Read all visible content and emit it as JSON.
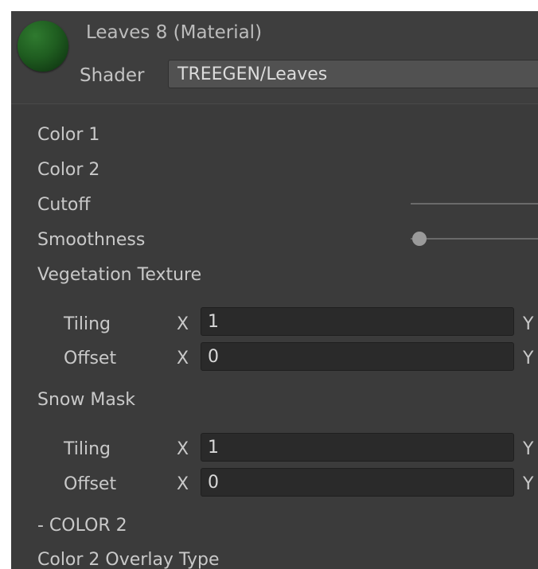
{
  "material": {
    "title": "Leaves 8 (Material)",
    "shader_label": "Shader",
    "shader_value": "TREEGEN/Leaves"
  },
  "properties": {
    "color1": "Color 1",
    "color2": "Color 2",
    "cutoff": "Cutoff",
    "smoothness": "Smoothness",
    "vegetation_texture": "Vegetation Texture",
    "snow_mask": "Snow Mask",
    "color2_header": "- COLOR 2",
    "color2_overlay_type": "Color 2 Overlay Type"
  },
  "vegetation": {
    "tiling_label": "Tiling",
    "offset_label": "Offset",
    "x_label": "X",
    "y_label": "Y",
    "tiling_x": "1",
    "offset_x": "0"
  },
  "snow": {
    "tiling_label": "Tiling",
    "offset_label": "Offset",
    "x_label": "X",
    "y_label": "Y",
    "tiling_x": "1",
    "offset_x": "0"
  },
  "colors": {
    "panel_bg": "#3b3b3b",
    "field_bg": "#2a2a2a",
    "sphere_green": "#1f5d20"
  },
  "icons": {
    "preview": "material-preview-sphere-icon"
  }
}
